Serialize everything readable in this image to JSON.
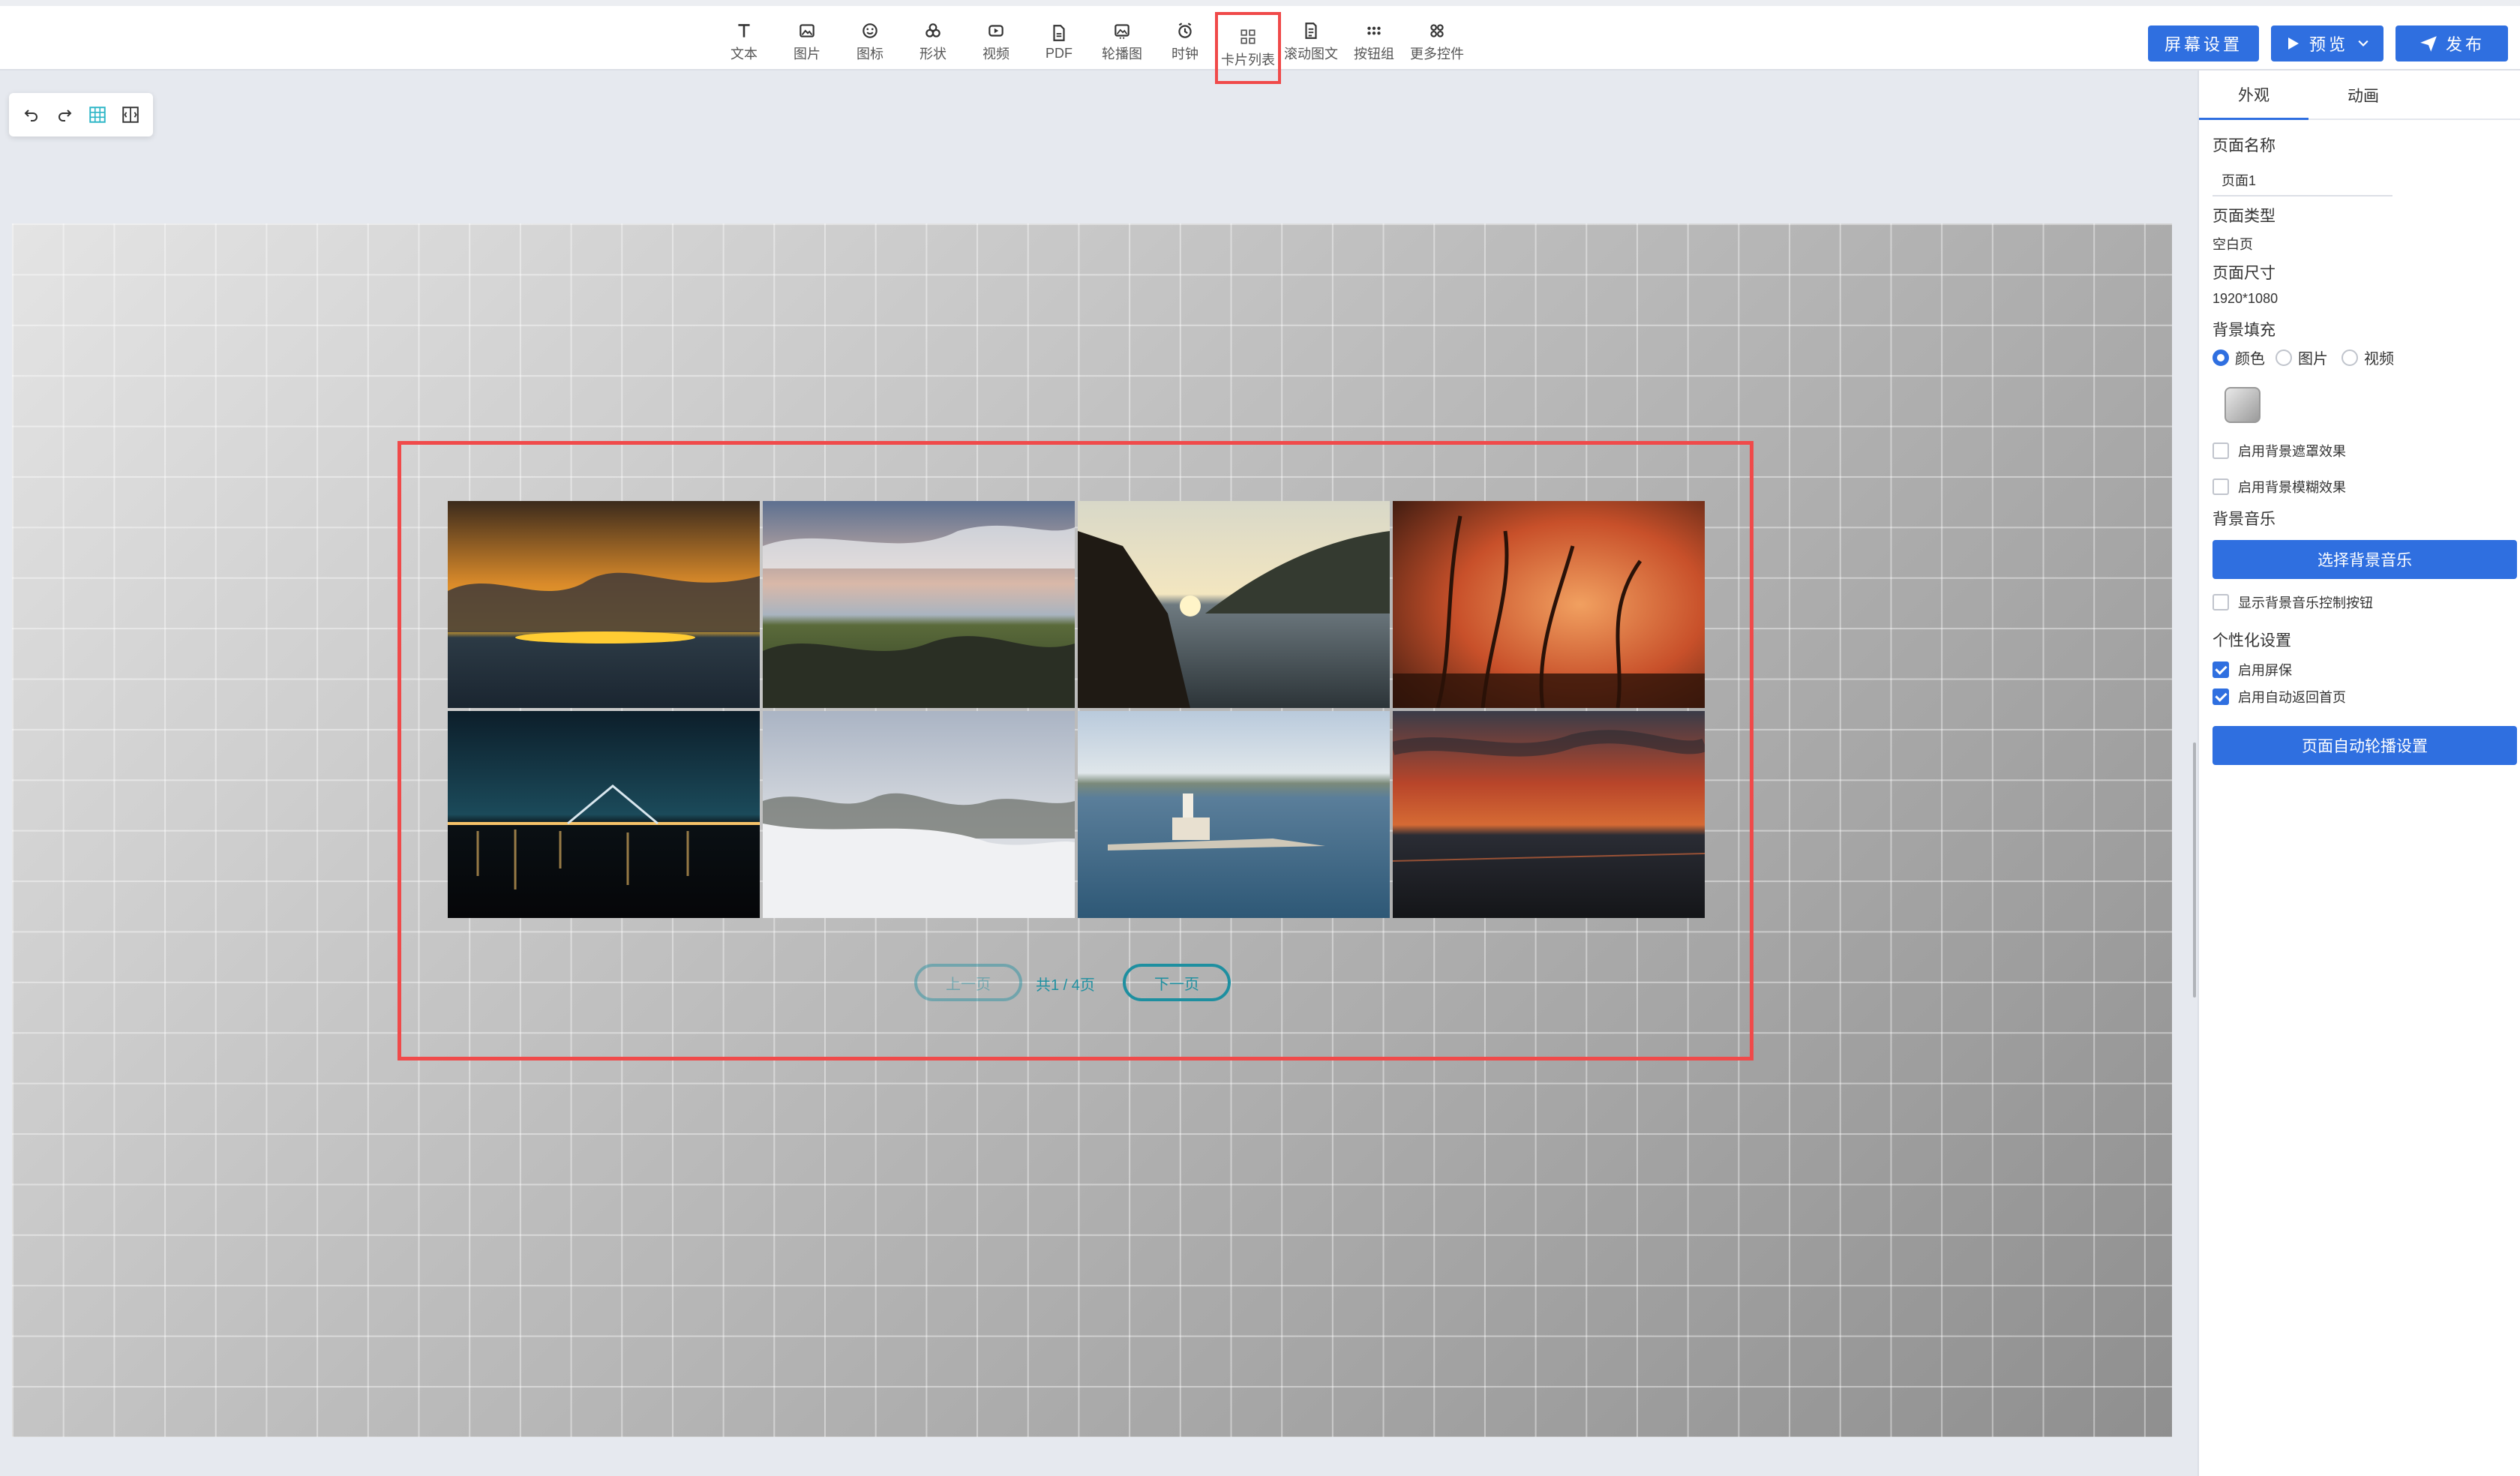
{
  "toolbar": {
    "tools": [
      {
        "label": "文本",
        "icon": "text-icon"
      },
      {
        "label": "图片",
        "icon": "image-icon"
      },
      {
        "label": "图标",
        "icon": "emoji-icon"
      },
      {
        "label": "形状",
        "icon": "shapes-icon"
      },
      {
        "label": "视频",
        "icon": "video-icon"
      },
      {
        "label": "PDF",
        "icon": "pdf-icon"
      },
      {
        "label": "轮播图",
        "icon": "carousel-icon"
      },
      {
        "label": "时钟",
        "icon": "clock-icon"
      },
      {
        "label": "卡片列表",
        "icon": "card-list-icon"
      },
      {
        "label": "滚动图文",
        "icon": "scroll-text-icon"
      },
      {
        "label": "按钮组",
        "icon": "button-group-icon"
      },
      {
        "label": "更多控件",
        "icon": "more-widgets-icon"
      }
    ],
    "active_tool": "卡片列表",
    "screen_settings": "屏幕设置",
    "preview": "预览",
    "publish": "发布"
  },
  "minibar": {
    "icons": [
      "undo-icon",
      "redo-icon",
      "grid-icon",
      "align-icon"
    ]
  },
  "canvas": {
    "card_list": {
      "photos": [
        {
          "icon": "sunset-sea-photo"
        },
        {
          "icon": "grass-dunes-photo"
        },
        {
          "icon": "lake-mountain-photo"
        },
        {
          "icon": "grass-sunset-photo"
        },
        {
          "icon": "city-night-bridge-photo"
        },
        {
          "icon": "foggy-forest-photo"
        },
        {
          "icon": "lighthouse-island-photo"
        },
        {
          "icon": "red-clouds-sea-photo"
        }
      ],
      "prev_label": "上一页",
      "page_info": "共1 / 4页",
      "next_label": "下一页"
    }
  },
  "panel": {
    "tabs": [
      "外观",
      "动画"
    ],
    "active_tab": "外观",
    "page_name_label": "页面名称",
    "page_name_value": "页面1",
    "page_type_label": "页面类型",
    "page_type_value": "空白页",
    "page_size_label": "页面尺寸",
    "page_size_value": "1920*1080",
    "bg_fill_label": "背景填充",
    "bg_options": [
      "颜色",
      "图片",
      "视频"
    ],
    "bg_selected": "颜色",
    "mask_effect": "启用背景遮罩效果",
    "blur_effect": "启用背景模糊效果",
    "bg_music_label": "背景音乐",
    "choose_music": "选择背景音乐",
    "show_music_ctrl": "显示背景音乐控制按钮",
    "personal_label": "个性化设置",
    "screensaver": "启用屏保",
    "auto_return": "启用自动返回首页",
    "auto_carousel": "页面自动轮播设置"
  },
  "colors": {
    "accent": "#2f6fe0",
    "highlight": "#f04a4a",
    "pager": "#1e8fa0"
  }
}
